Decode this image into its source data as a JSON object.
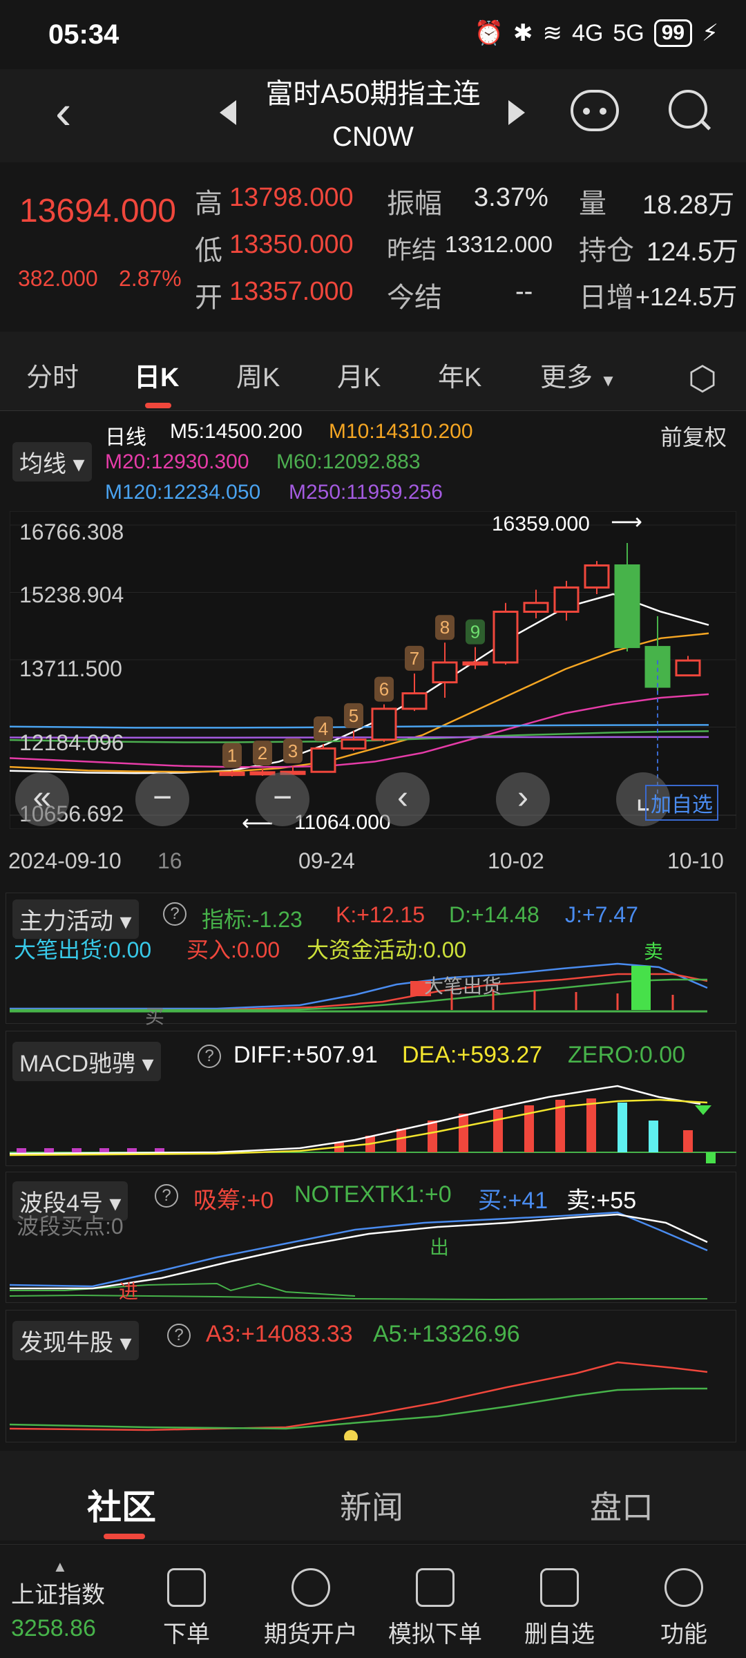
{
  "status": {
    "time": "05:34",
    "signal1": "4G",
    "signal2": "5G",
    "battery": "99"
  },
  "header": {
    "title": "富时A50期指主连",
    "code": "CN0W"
  },
  "quote": {
    "price": "13694.000",
    "change": "382.000",
    "change_pct": "2.87%",
    "high_label": "高",
    "high": "13798.000",
    "low_label": "低",
    "low": "13350.000",
    "open_label": "开",
    "open": "13357.000",
    "amp_label": "振幅",
    "amp": "3.37%",
    "prev_label": "昨结",
    "prev": "13312.000",
    "settle_label": "今结",
    "settle": "-- ",
    "vol_label": "量",
    "vol": "18.28万",
    "oi_label": "持仓",
    "oi": "124.5万",
    "dinc_label": "日增",
    "dinc": "+124.5万"
  },
  "tabs": [
    "分时",
    "日K",
    "周K",
    "月K",
    "年K",
    "更多"
  ],
  "ma": {
    "select": "均线",
    "line_label": "日线",
    "m5": "M5:14500.200",
    "m10": "M10:14310.200",
    "m20": "M20:12930.300",
    "m60": "M60:12092.883",
    "m120": "M120:12234.050",
    "m250": "M250:11959.256",
    "adjust": "前复权"
  },
  "chart_data": {
    "type": "candlestick",
    "y_ticks": [
      "16766.308",
      "15238.904",
      "13711.500",
      "12184.096",
      "10656.692"
    ],
    "x_ticks": [
      "2024-09-10",
      "16",
      "09-24",
      "10-02",
      "10-10"
    ],
    "max_label": "16359.000",
    "min_label": "11064.000",
    "candles": [
      {
        "o": 11100,
        "c": 11150,
        "h": 11200,
        "l": 11064
      },
      {
        "o": 11120,
        "c": 11160,
        "h": 11250,
        "l": 11080
      },
      {
        "o": 11150,
        "c": 11170,
        "h": 11300,
        "l": 11100
      },
      {
        "o": 11170,
        "c": 11700,
        "h": 11800,
        "l": 11150
      },
      {
        "o": 11700,
        "c": 11900,
        "h": 12100,
        "l": 11650
      },
      {
        "o": 11900,
        "c": 12600,
        "h": 12700,
        "l": 11850
      },
      {
        "o": 12600,
        "c": 12950,
        "h": 13400,
        "l": 12550
      },
      {
        "o": 13200,
        "c": 13650,
        "h": 14100,
        "l": 12850
      },
      {
        "o": 13650,
        "c": 13650,
        "h": 14000,
        "l": 13500
      },
      {
        "o": 13650,
        "c": 14800,
        "h": 15000,
        "l": 13600
      },
      {
        "o": 14800,
        "c": 15000,
        "h": 15300,
        "l": 14650
      },
      {
        "o": 14800,
        "c": 15350,
        "h": 15500,
        "l": 14600
      },
      {
        "o": 15350,
        "c": 15850,
        "h": 15950,
        "l": 15200
      },
      {
        "o": 15850,
        "c": 14000,
        "h": 16359,
        "l": 13900
      },
      {
        "o": 14000,
        "c": 13100,
        "h": 14700,
        "l": 13000
      },
      {
        "o": 13357,
        "c": 13694,
        "h": 13798,
        "l": 13350
      }
    ],
    "signals": [
      "1",
      "2",
      "3",
      "4",
      "5",
      "6",
      "7",
      "8",
      "9"
    ],
    "add_fav": "加自选"
  },
  "ind1": {
    "select": "主力活动",
    "zb": "指标:-1.23",
    "k": "K:+12.15",
    "d": "D:+14.48",
    "j": "J:+7.47",
    "dbch": "大笔出货:0.00",
    "mr": "买入:0.00",
    "dzj": "大资金活动:0.00",
    "sell": "卖",
    "buy": "买",
    "note": "大笔出货"
  },
  "macd": {
    "select": "MACD驰骋",
    "diff": "DIFF:+507.91",
    "dea": "DEA:+593.27",
    "zero": "ZERO:0.00"
  },
  "wave": {
    "select": "波段4号",
    "xc": "吸筹:+0",
    "note": "NOTEXTK1:+0",
    "buy": "买:+41",
    "sell": "卖:+55",
    "point": "波段买点:0",
    "out": "出",
    "in": "进"
  },
  "bull": {
    "select": "发现牛股",
    "a3": "A3:+14083.33",
    "a5": "A5:+13326.96"
  },
  "bottom_tabs": [
    "社区",
    "新闻",
    "盘口"
  ],
  "toolbar": {
    "index_name": "上证指数",
    "index_val": "3258.86",
    "items": [
      "下单",
      "期货开户",
      "模拟下单",
      "删自选",
      "功能"
    ]
  }
}
